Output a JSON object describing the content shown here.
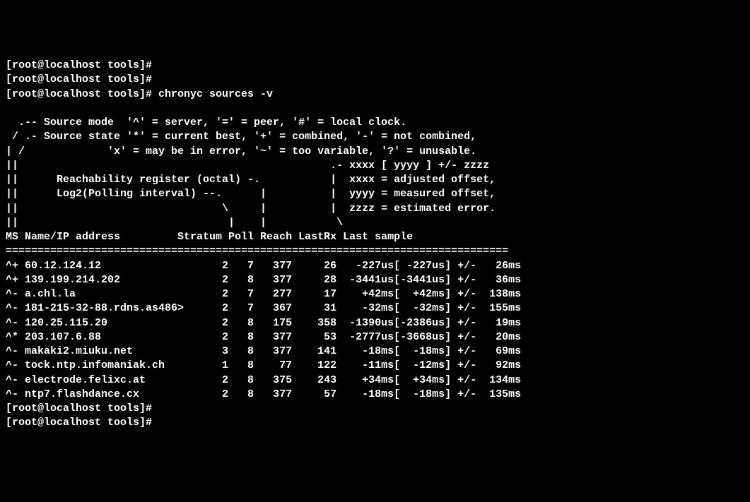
{
  "prompt_truncated": "[root@localhost tools]#",
  "prompt": "[root@localhost tools]#",
  "command": "chronyc sources -v",
  "help": {
    "line1": "  .-- Source mode  '^' = server, '=' = peer, '#' = local clock.",
    "line2": " / .- Source state '*' = current best, '+' = combined, '-' = not combined,",
    "line3": "| /             'x' = may be in error, '~' = too variable, '?' = unusable.",
    "line4": "||                                                 .- xxxx [ yyyy ] +/- zzzz",
    "line5": "||      Reachability register (octal) -.           |  xxxx = adjusted offset,",
    "line6": "||      Log2(Polling interval) --.      |          |  yyyy = measured offset,",
    "line7": "||                                \\     |          |  zzzz = estimated error.",
    "line8": "||                                 |    |           \\"
  },
  "header": "MS Name/IP address         Stratum Poll Reach LastRx Last sample",
  "divider": "===============================================================================",
  "rows": [
    {
      "ms": "^+",
      "name": "60.12.124.12",
      "stratum": "2",
      "poll": "7",
      "reach": "377",
      "lastrx": "26",
      "adj": "-227us",
      "meas": "-227us",
      "err": "26ms"
    },
    {
      "ms": "^+",
      "name": "139.199.214.202",
      "stratum": "2",
      "poll": "8",
      "reach": "377",
      "lastrx": "28",
      "adj": "-3441us",
      "meas": "-3441us",
      "err": "36ms"
    },
    {
      "ms": "^-",
      "name": "a.chl.la",
      "stratum": "2",
      "poll": "7",
      "reach": "277",
      "lastrx": "17",
      "adj": "+42ms",
      "meas": "+42ms",
      "err": "138ms"
    },
    {
      "ms": "^-",
      "name": "181-215-32-88.rdns.as486>",
      "stratum": "2",
      "poll": "7",
      "reach": "367",
      "lastrx": "31",
      "adj": "-32ms",
      "meas": "-32ms",
      "err": "155ms"
    },
    {
      "ms": "^-",
      "name": "120.25.115.20",
      "stratum": "2",
      "poll": "8",
      "reach": "175",
      "lastrx": "358",
      "adj": "-1390us",
      "meas": "-2386us",
      "err": "19ms"
    },
    {
      "ms": "^*",
      "name": "203.107.6.88",
      "stratum": "2",
      "poll": "8",
      "reach": "377",
      "lastrx": "53",
      "adj": "-2777us",
      "meas": "-3668us",
      "err": "20ms"
    },
    {
      "ms": "^-",
      "name": "makaki2.miuku.net",
      "stratum": "3",
      "poll": "8",
      "reach": "377",
      "lastrx": "141",
      "adj": "-18ms",
      "meas": "-18ms",
      "err": "69ms"
    },
    {
      "ms": "^-",
      "name": "tock.ntp.infomaniak.ch",
      "stratum": "1",
      "poll": "8",
      "reach": "77",
      "lastrx": "122",
      "adj": "-11ms",
      "meas": "-12ms",
      "err": "92ms"
    },
    {
      "ms": "^-",
      "name": "electrode.felixc.at",
      "stratum": "2",
      "poll": "8",
      "reach": "375",
      "lastrx": "243",
      "adj": "+34ms",
      "meas": "+34ms",
      "err": "134ms"
    },
    {
      "ms": "^-",
      "name": "ntp7.flashdance.cx",
      "stratum": "2",
      "poll": "8",
      "reach": "377",
      "lastrx": "57",
      "adj": "-18ms",
      "meas": "-18ms",
      "err": "135ms"
    }
  ]
}
